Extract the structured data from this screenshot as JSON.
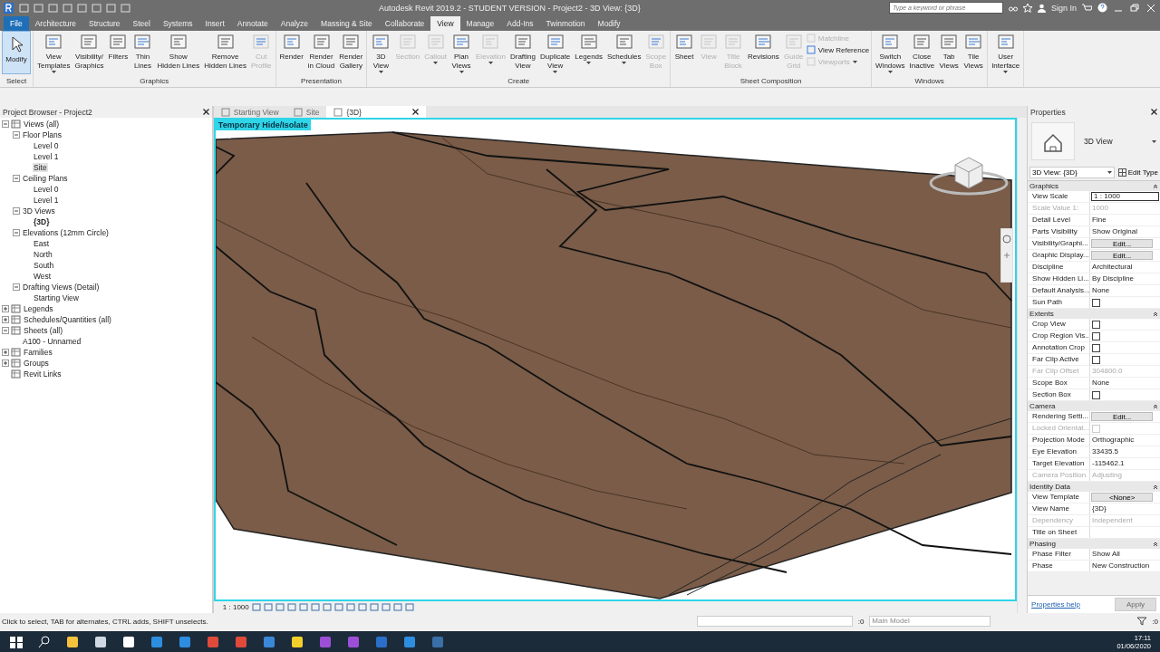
{
  "window": {
    "title": "Autodesk Revit 2019.2 - STUDENT VERSION - Project2 - 3D View: {3D}",
    "search": {
      "placeholder": "Type a keyword or phrase"
    },
    "sign_in": "Sign In"
  },
  "menu_tabs": [
    {
      "label": "File",
      "kind": "file",
      "selected": false
    },
    {
      "label": "Architecture",
      "kind": "tab",
      "selected": false
    },
    {
      "label": "Structure",
      "kind": "tab",
      "selected": false
    },
    {
      "label": "Steel",
      "kind": "tab",
      "selected": false
    },
    {
      "label": "Systems",
      "kind": "tab",
      "selected": false
    },
    {
      "label": "Insert",
      "kind": "tab",
      "selected": false
    },
    {
      "label": "Annotate",
      "kind": "tab",
      "selected": false
    },
    {
      "label": "Analyze",
      "kind": "tab",
      "selected": false
    },
    {
      "label": "Massing & Site",
      "kind": "tab",
      "selected": false
    },
    {
      "label": "Collaborate",
      "kind": "tab",
      "selected": false
    },
    {
      "label": "View",
      "kind": "tab",
      "selected": true
    },
    {
      "label": "Manage",
      "kind": "tab",
      "selected": false
    },
    {
      "label": "Add-Ins",
      "kind": "tab",
      "selected": false
    },
    {
      "label": "Twinmotion",
      "kind": "tab",
      "selected": false
    },
    {
      "label": "Modify",
      "kind": "tab",
      "selected": false
    }
  ],
  "ribbon": {
    "select_panel": {
      "button": "Modify",
      "label": "Select"
    },
    "panels": [
      {
        "label": "Graphics",
        "buttons": [
          {
            "kind": "large",
            "lines": [
              "View",
              "Templates"
            ],
            "dropdown": true,
            "disabled": false
          },
          {
            "kind": "large",
            "lines": [
              "Visibility/",
              "Graphics"
            ],
            "dropdown": false,
            "disabled": false
          },
          {
            "kind": "large",
            "lines": [
              "Filters"
            ],
            "dropdown": false,
            "disabled": false
          },
          {
            "kind": "large",
            "lines": [
              "Thin",
              "Lines"
            ],
            "dropdown": false,
            "disabled": false
          },
          {
            "kind": "large",
            "lines": [
              "Show",
              "Hidden Lines"
            ],
            "dropdown": false,
            "disabled": false
          },
          {
            "kind": "large",
            "lines": [
              "Remove",
              "Hidden Lines"
            ],
            "dropdown": false,
            "disabled": false
          },
          {
            "kind": "large",
            "lines": [
              "Cut",
              "Profile"
            ],
            "dropdown": false,
            "disabled": true
          }
        ]
      },
      {
        "label": "Presentation",
        "buttons": [
          {
            "kind": "large",
            "lines": [
              "Render"
            ],
            "dropdown": false,
            "disabled": false
          },
          {
            "kind": "large",
            "lines": [
              "Render",
              "in Cloud"
            ],
            "dropdown": false,
            "disabled": false
          },
          {
            "kind": "large",
            "lines": [
              "Render",
              "Gallery"
            ],
            "dropdown": false,
            "disabled": false
          }
        ]
      },
      {
        "label": "Create",
        "buttons": [
          {
            "kind": "large",
            "lines": [
              "3D",
              "View"
            ],
            "dropdown": true,
            "disabled": false
          },
          {
            "kind": "large",
            "lines": [
              "Section"
            ],
            "dropdown": false,
            "disabled": true
          },
          {
            "kind": "large",
            "lines": [
              "Callout"
            ],
            "dropdown": true,
            "disabled": true
          },
          {
            "kind": "large",
            "lines": [
              "Plan",
              "Views"
            ],
            "dropdown": true,
            "disabled": false
          },
          {
            "kind": "large",
            "lines": [
              "Elevation"
            ],
            "dropdown": true,
            "disabled": true
          },
          {
            "kind": "large",
            "lines": [
              "Drafting",
              "View"
            ],
            "dropdown": false,
            "disabled": false
          },
          {
            "kind": "large",
            "lines": [
              "Duplicate",
              "View"
            ],
            "dropdown": true,
            "disabled": false
          },
          {
            "kind": "large",
            "lines": [
              "Legends"
            ],
            "dropdown": true,
            "disabled": false
          },
          {
            "kind": "large",
            "lines": [
              "Schedules"
            ],
            "dropdown": true,
            "disabled": false
          },
          {
            "kind": "large",
            "lines": [
              "Scope",
              "Box"
            ],
            "dropdown": false,
            "disabled": true
          }
        ]
      },
      {
        "label": "Sheet Composition",
        "buttons": [
          {
            "kind": "large",
            "lines": [
              "Sheet"
            ],
            "dropdown": false,
            "disabled": false
          },
          {
            "kind": "large",
            "lines": [
              "View"
            ],
            "dropdown": false,
            "disabled": true
          },
          {
            "kind": "large",
            "lines": [
              "Title",
              "Block"
            ],
            "dropdown": false,
            "disabled": true
          },
          {
            "kind": "large",
            "lines": [
              "Revisions"
            ],
            "dropdown": false,
            "disabled": false
          },
          {
            "kind": "large",
            "lines": [
              "Guide",
              "Grid"
            ],
            "dropdown": false,
            "disabled": true
          },
          {
            "kind": "small",
            "lines": [
              "Matchline"
            ],
            "dropdown": false,
            "disabled": true
          },
          {
            "kind": "small",
            "lines": [
              "View  Reference"
            ],
            "dropdown": false,
            "disabled": false
          },
          {
            "kind": "small",
            "lines": [
              "Viewports"
            ],
            "dropdown": true,
            "disabled": true
          }
        ]
      },
      {
        "label": "Windows",
        "buttons": [
          {
            "kind": "large",
            "lines": [
              "Switch",
              "Windows"
            ],
            "dropdown": true,
            "disabled": false
          },
          {
            "kind": "large",
            "lines": [
              "Close",
              "Inactive"
            ],
            "dropdown": false,
            "disabled": false
          },
          {
            "kind": "large",
            "lines": [
              "Tab",
              "Views"
            ],
            "dropdown": false,
            "disabled": false
          },
          {
            "kind": "large",
            "lines": [
              "Tile",
              "Views"
            ],
            "dropdown": false,
            "disabled": false
          }
        ]
      },
      {
        "buttons": [
          {
            "kind": "large",
            "lines": [
              "User",
              "Interface"
            ],
            "dropdown": true,
            "disabled": false
          }
        ]
      }
    ]
  },
  "project_browser": {
    "title": "Project Browser - Project2",
    "tree": [
      {
        "label": "Views (all)",
        "expanded": true,
        "selected": false,
        "current": false,
        "children": [
          {
            "label": "Floor Plans",
            "expanded": true,
            "selected": false,
            "current": false,
            "children": [
              {
                "label": "Level 0",
                "selected": false,
                "current": false
              },
              {
                "label": "Level 1",
                "selected": false,
                "current": false
              },
              {
                "label": "Site",
                "selected": true,
                "current": false
              }
            ]
          },
          {
            "label": "Ceiling Plans",
            "expanded": true,
            "selected": false,
            "current": false,
            "children": [
              {
                "label": "Level 0",
                "selected": false,
                "current": false
              },
              {
                "label": "Level 1",
                "selected": false,
                "current": false
              }
            ]
          },
          {
            "label": "3D Views",
            "expanded": true,
            "selected": false,
            "current": false,
            "children": [
              {
                "label": "{3D}",
                "selected": false,
                "current": true
              }
            ]
          },
          {
            "label": "Elevations (12mm Circle)",
            "expanded": true,
            "selected": false,
            "current": false,
            "children": [
              {
                "label": "East",
                "selected": false,
                "current": false
              },
              {
                "label": "North",
                "selected": false,
                "current": false
              },
              {
                "label": "South",
                "selected": false,
                "current": false
              },
              {
                "label": "West",
                "selected": false,
                "current": false
              }
            ]
          },
          {
            "label": "Drafting Views (Detail)",
            "expanded": true,
            "selected": false,
            "current": false,
            "children": [
              {
                "label": "Starting View",
                "selected": false,
                "current": false
              }
            ]
          }
        ]
      },
      {
        "label": "Legends",
        "expanded": false,
        "selected": false,
        "current": false
      },
      {
        "label": "Schedules/Quantities (all)",
        "expanded": false,
        "selected": false,
        "current": false
      },
      {
        "label": "Sheets (all)",
        "expanded": true,
        "selected": false,
        "current": false,
        "children": [
          {
            "label": "A100 - Unnamed",
            "selected": false,
            "current": false
          }
        ]
      },
      {
        "label": "Families",
        "expanded": false,
        "selected": false,
        "current": false
      },
      {
        "label": "Groups",
        "expanded": false,
        "selected": false,
        "current": false
      },
      {
        "label": "Revit Links",
        "selected": false,
        "current": false
      }
    ]
  },
  "view_tabs": [
    {
      "label": "Starting View",
      "selected": false
    },
    {
      "label": "Site",
      "selected": false
    },
    {
      "label": "{3D}",
      "selected": true
    }
  ],
  "view": {
    "isolate_banner": "Temporary Hide/Isolate",
    "scale": "1 : 1000"
  },
  "properties": {
    "title": "Properties",
    "type_name": "3D View",
    "selector": "3D View: {3D}",
    "edit_type": "Edit Type",
    "sections": [
      {
        "title": "Graphics",
        "rows": [
          {
            "label": "View Scale",
            "kind": "field",
            "value": "1 : 1000",
            "disabled": false
          },
          {
            "label": "Scale Value    1:",
            "kind": "text",
            "value": "1000",
            "disabled": true
          },
          {
            "label": "Detail Level",
            "kind": "text",
            "value": "Fine",
            "disabled": false
          },
          {
            "label": "Parts Visibility",
            "kind": "text",
            "value": "Show Original",
            "disabled": false
          },
          {
            "label": "Visibility/Graphi...",
            "kind": "button",
            "value": "Edit...",
            "disabled": false
          },
          {
            "label": "Graphic Display...",
            "kind": "button",
            "value": "Edit...",
            "disabled": false
          },
          {
            "label": "Discipline",
            "kind": "text",
            "value": "Architectural",
            "disabled": false
          },
          {
            "label": "Show Hidden Li...",
            "kind": "text",
            "value": "By Discipline",
            "disabled": false
          },
          {
            "label": "Default Analysis...",
            "kind": "text",
            "value": "None",
            "disabled": false
          },
          {
            "label": "Sun Path",
            "kind": "checkbox",
            "checked": false,
            "disabled": false
          }
        ]
      },
      {
        "title": "Extents",
        "rows": [
          {
            "label": "Crop View",
            "kind": "checkbox",
            "checked": false,
            "disabled": false
          },
          {
            "label": "Crop Region Vis...",
            "kind": "checkbox",
            "checked": false,
            "disabled": false
          },
          {
            "label": "Annotation Crop",
            "kind": "checkbox",
            "checked": false,
            "disabled": false
          },
          {
            "label": "Far Clip Active",
            "kind": "checkbox",
            "checked": false,
            "disabled": false
          },
          {
            "label": "Far Clip Offset",
            "kind": "text",
            "value": "304800.0",
            "disabled": true
          },
          {
            "label": "Scope Box",
            "kind": "text",
            "value": "None",
            "disabled": false
          },
          {
            "label": "Section Box",
            "kind": "checkbox",
            "checked": false,
            "disabled": false
          }
        ]
      },
      {
        "title": "Camera",
        "rows": [
          {
            "label": "Rendering Setti...",
            "kind": "button",
            "value": "Edit...",
            "disabled": false
          },
          {
            "label": "Locked Orientat...",
            "kind": "checkbox",
            "checked": false,
            "disabled": true
          },
          {
            "label": "Projection Mode",
            "kind": "text",
            "value": "Orthographic",
            "disabled": false
          },
          {
            "label": "Eye Elevation",
            "kind": "text",
            "value": "33435.5",
            "disabled": false
          },
          {
            "label": "Target Elevation",
            "kind": "text",
            "value": "-115462.1",
            "disabled": false
          },
          {
            "label": "Camera Position",
            "kind": "text",
            "value": "Adjusting",
            "disabled": true
          }
        ]
      },
      {
        "title": "Identity Data",
        "rows": [
          {
            "label": "View Template",
            "kind": "button",
            "value": "<None>",
            "disabled": false
          },
          {
            "label": "View Name",
            "kind": "text",
            "value": "{3D}",
            "disabled": false
          },
          {
            "label": "Dependency",
            "kind": "text",
            "value": "Independent",
            "disabled": true
          },
          {
            "label": "Title on Sheet",
            "kind": "text",
            "disabled": false
          }
        ]
      },
      {
        "title": "Phasing",
        "rows": [
          {
            "label": "Phase Filter",
            "kind": "text",
            "value": "Show All",
            "disabled": false
          },
          {
            "label": "Phase",
            "kind": "text",
            "value": "New Construction",
            "disabled": false
          }
        ]
      }
    ],
    "help_link": "Properties help",
    "apply": {
      "label": "Apply",
      "disabled": true
    }
  },
  "status_bar": {
    "message": "Click to select, TAB for alternates, CTRL adds, SHIFT unselects.",
    "selection_count": ":0",
    "model": "Main Model",
    "filter_count": ":0"
  },
  "taskbar": {
    "time": "17:11",
    "date": "01/06/2020"
  }
}
